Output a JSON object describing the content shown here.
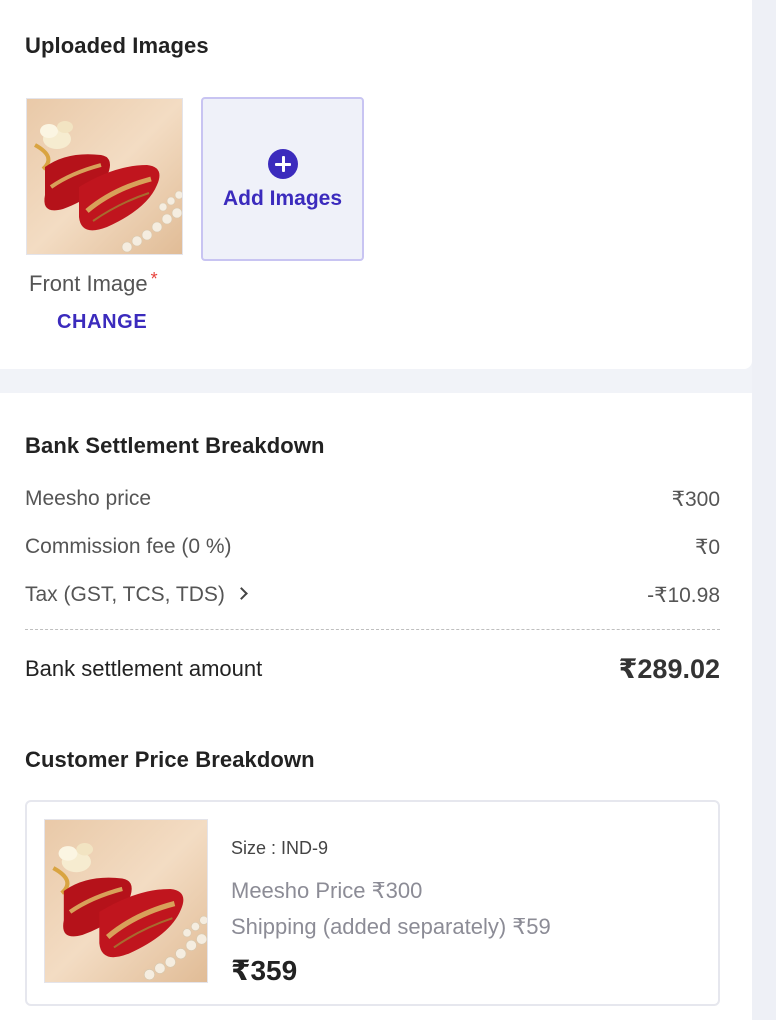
{
  "uploaded": {
    "title": "Uploaded Images",
    "front_label": "Front Image",
    "required_mark": "*",
    "change_label": "CHANGE",
    "add_label": "Add Images"
  },
  "settlement": {
    "title": "Bank Settlement Breakdown",
    "rows": [
      {
        "label": "Meesho price",
        "value": "₹300"
      },
      {
        "label": "Commission fee (0 %)",
        "value": "₹0"
      },
      {
        "label": "Tax (GST, TCS, TDS)",
        "value": "-₹10.98"
      }
    ],
    "total_label": "Bank settlement amount",
    "total_value": "₹289.02"
  },
  "customer": {
    "title": "Customer Price Breakdown",
    "size": "Size : IND-9",
    "meesho_price": "Meesho Price ₹300",
    "shipping": "Shipping (added separately) ₹59",
    "price": "₹359"
  },
  "colors": {
    "accent": "#3b2bbd",
    "required": "#e6423c",
    "add_box_bg": "#eff1f9",
    "add_box_border": "#c8c4f2"
  }
}
